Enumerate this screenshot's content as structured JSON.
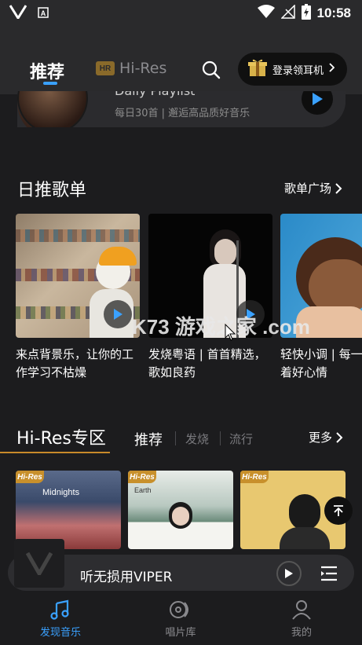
{
  "status_bar": {
    "time": "10:58"
  },
  "header": {
    "tab_recommend": "推荐",
    "tab_hires_badge": "HR",
    "tab_hires": "Hi-Res",
    "promo_label": "登录领耳机"
  },
  "daily": {
    "title": "Daily Playlist",
    "subtitle": "每日30首 | 邂逅高品质好音乐"
  },
  "daily_section": {
    "title": "日推歌单",
    "more": "歌单广场"
  },
  "playlists": [
    {
      "title": "来点背景乐，让你的工作学习不枯燥"
    },
    {
      "title": "发烧粤语 | 首首精选，歌如良药"
    },
    {
      "title": "轻快小调 | 每一首都藏着好心情"
    }
  ],
  "hires_section": {
    "title": "Hi-Res专区",
    "tabs": [
      "推荐",
      "发烧",
      "流行"
    ],
    "more": "更多"
  },
  "albums": [
    {
      "badge": "Hi-Res",
      "name": "Midnights"
    },
    {
      "badge": "Hi-Res",
      "name": "Earth"
    },
    {
      "badge": "Hi-Res",
      "name": ""
    }
  ],
  "watermark": "K73 游戏之家 .com",
  "mini_player": {
    "title": "听无损用VIPER"
  },
  "bottom_nav": {
    "discover": "发现音乐",
    "records": "唱片库",
    "mine": "我的"
  },
  "colors": {
    "accent": "#3aa1ff",
    "hires_gold": "#c88a2a",
    "background": "#1c1c1e"
  }
}
